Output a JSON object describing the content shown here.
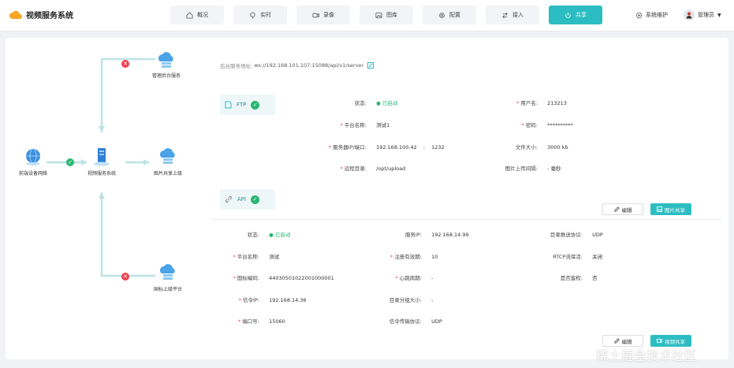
{
  "app": {
    "title": "视频服务系统"
  },
  "nav": [
    {
      "label": "概况",
      "icon": "home-icon"
    },
    {
      "label": "实时",
      "icon": "location-icon"
    },
    {
      "label": "录像",
      "icon": "video-icon"
    },
    {
      "label": "图库",
      "icon": "image-icon"
    },
    {
      "label": "配置",
      "icon": "gear-icon"
    },
    {
      "label": "接入",
      "icon": "connect-icon"
    },
    {
      "label": "共享",
      "icon": "share-icon",
      "active": true
    }
  ],
  "header": {
    "maintenance": "系统维护",
    "user": "管理员"
  },
  "topology": {
    "nodes": {
      "mgmt": "管理后台服务",
      "front": "前端设备网络",
      "video": "视频服务系统",
      "imgshare": "图片共享上级",
      "national": "国标上级平台"
    }
  },
  "server_address": {
    "label": "后台服务地址:",
    "value": "ws://192.168.101.107:15088/api/v1/server"
  },
  "ftp": {
    "title": "FTP",
    "fields": {
      "status": {
        "label": "状态:",
        "value": "已启动"
      },
      "username": {
        "label": "用户名:",
        "value": "213213"
      },
      "platform": {
        "label": "平台名称:",
        "value": "测试1"
      },
      "password": {
        "label": "密码:",
        "value": "**********"
      },
      "server": {
        "label": "服务器IP/端口:",
        "ip": "192.168.100.42",
        "sep": ":",
        "port": "1232"
      },
      "filesize": {
        "label": "文件大小:",
        "value": "3000 kb"
      },
      "remote": {
        "label": "远程目录:",
        "value": "/opt/upload"
      },
      "interval": {
        "label": "图片上传间隔:",
        "value": "- 毫秒"
      }
    },
    "edit": "编辑",
    "share": "图片共享"
  },
  "api": {
    "title": "API",
    "fields": {
      "status": {
        "label": "状态:",
        "value": "已启动"
      },
      "service_ip": {
        "label": "服务IP:",
        "value": "192.168.14.99"
      },
      "push_protocol": {
        "label": "目录推送协议:",
        "value": "UDP"
      },
      "platform": {
        "label": "平台名称:",
        "value": "测试"
      },
      "validity": {
        "label": "注册有效期:",
        "value": "10"
      },
      "rtcp": {
        "label": "RTCP流保活:",
        "value": "关闭"
      },
      "gb_code": {
        "label": "国标编码:",
        "value": "44030501022001000001"
      },
      "heartbeat": {
        "label": "心跳周期:",
        "value": "-"
      },
      "auth": {
        "label": "是否鉴权:",
        "value": "否"
      },
      "signal_ip": {
        "label": "信令IP:",
        "value": "192.168.14.36"
      },
      "group_size": {
        "label": "目录分组大小:",
        "value": "-"
      },
      "port": {
        "label": "端口号:",
        "value": "15060"
      },
      "signal_protocol": {
        "label": "信令传输协议:",
        "value": "UDP"
      }
    },
    "edit": "编辑",
    "share": "视频共享"
  },
  "watermark": "稀土掘金技术社区"
}
